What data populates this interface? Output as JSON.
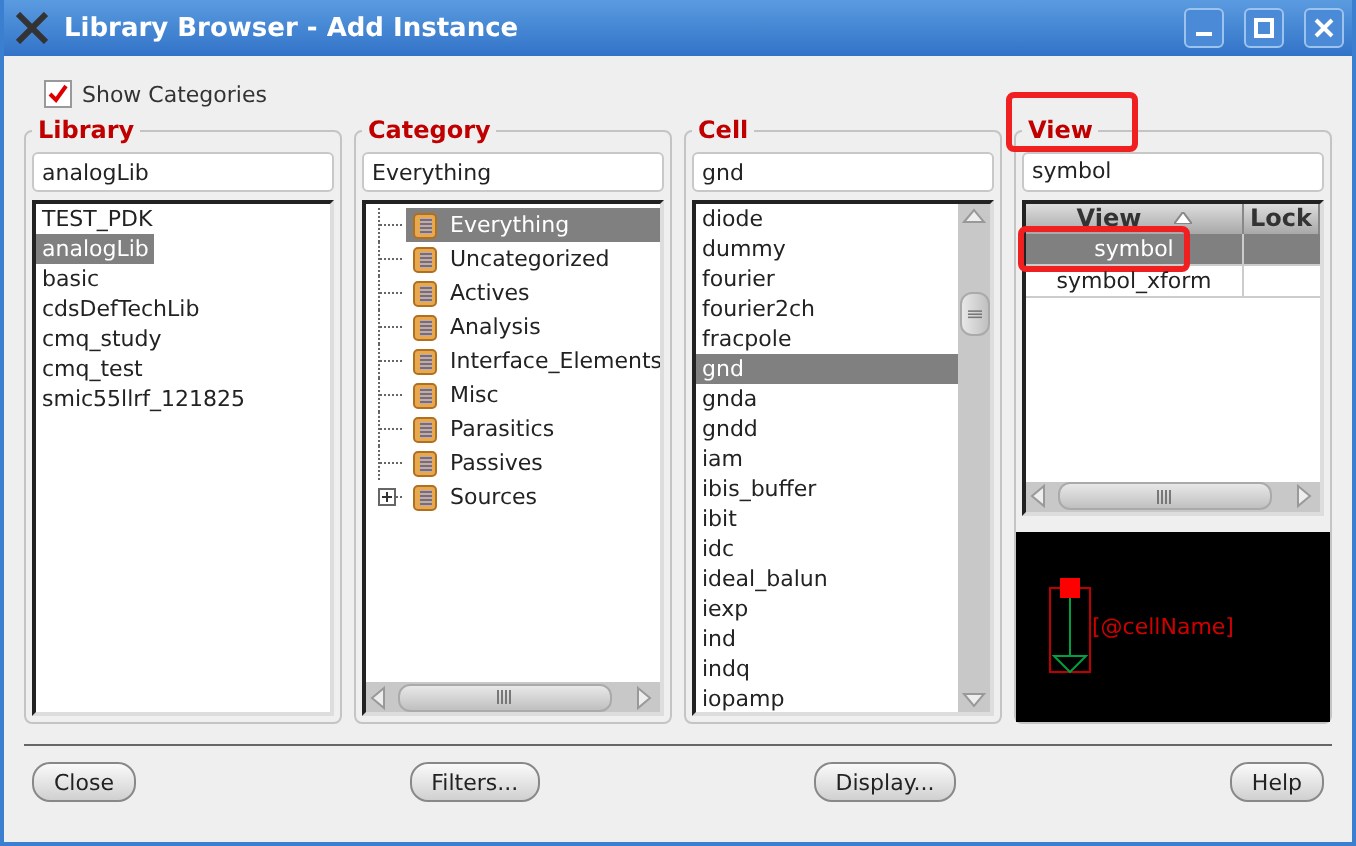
{
  "window": {
    "title": "Library Browser - Add Instance"
  },
  "show_categories": {
    "label": "Show Categories",
    "checked": true
  },
  "library": {
    "heading": "Library",
    "value": "analogLib",
    "items": [
      {
        "label": "TEST_PDK",
        "selected": false
      },
      {
        "label": "analogLib",
        "selected": true
      },
      {
        "label": "basic",
        "selected": false
      },
      {
        "label": "cdsDefTechLib",
        "selected": false
      },
      {
        "label": "cmq_study",
        "selected": false
      },
      {
        "label": "cmq_test",
        "selected": false
      },
      {
        "label": "smic55llrf_121825",
        "selected": false
      }
    ]
  },
  "category": {
    "heading": "Category",
    "value": "Everything",
    "items": [
      {
        "label": "Everything",
        "selected": true,
        "expandable": false
      },
      {
        "label": "Uncategorized",
        "selected": false,
        "expandable": false
      },
      {
        "label": "Actives",
        "selected": false,
        "expandable": false
      },
      {
        "label": "Analysis",
        "selected": false,
        "expandable": false
      },
      {
        "label": "Interface_Elements",
        "selected": false,
        "expandable": false
      },
      {
        "label": "Misc",
        "selected": false,
        "expandable": false
      },
      {
        "label": "Parasitics",
        "selected": false,
        "expandable": false
      },
      {
        "label": "Passives",
        "selected": false,
        "expandable": false
      },
      {
        "label": "Sources",
        "selected": false,
        "expandable": true
      }
    ]
  },
  "cell": {
    "heading": "Cell",
    "value": "gnd",
    "items": [
      {
        "label": "diode",
        "selected": false
      },
      {
        "label": "dummy",
        "selected": false
      },
      {
        "label": "fourier",
        "selected": false
      },
      {
        "label": "fourier2ch",
        "selected": false
      },
      {
        "label": "fracpole",
        "selected": false
      },
      {
        "label": "gnd",
        "selected": true
      },
      {
        "label": "gnda",
        "selected": false
      },
      {
        "label": "gndd",
        "selected": false
      },
      {
        "label": "iam",
        "selected": false
      },
      {
        "label": "ibis_buffer",
        "selected": false
      },
      {
        "label": "ibit",
        "selected": false
      },
      {
        "label": "idc",
        "selected": false
      },
      {
        "label": "ideal_balun",
        "selected": false
      },
      {
        "label": "iexp",
        "selected": false
      },
      {
        "label": "ind",
        "selected": false
      },
      {
        "label": "indq",
        "selected": false
      },
      {
        "label": "iopamp",
        "selected": false
      }
    ]
  },
  "view": {
    "heading": "View",
    "heading_highlighted": true,
    "value": "symbol",
    "columns": [
      "View",
      "Lock"
    ],
    "rows": [
      {
        "view": "symbol",
        "selected": true,
        "highlighted": true
      },
      {
        "view": "symbol_xform",
        "selected": false,
        "highlighted": false
      }
    ]
  },
  "preview": {
    "label": "[@cellName]"
  },
  "buttons": [
    "Close",
    "Filters...",
    "Display...",
    "Help"
  ]
}
